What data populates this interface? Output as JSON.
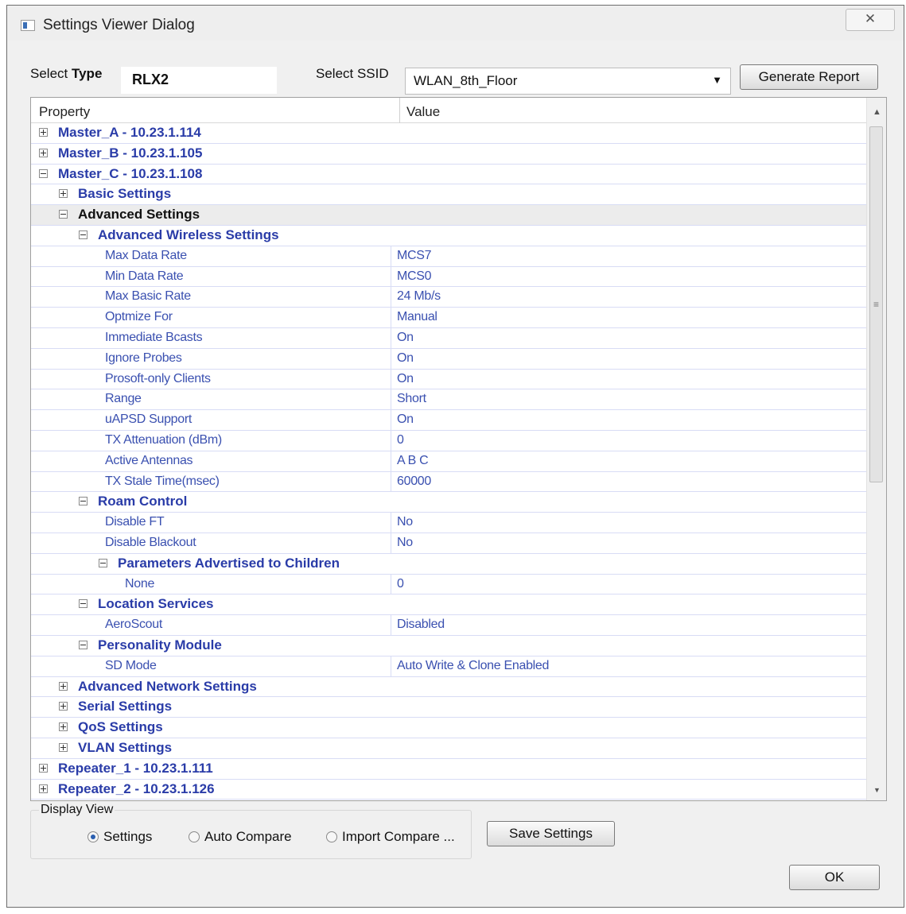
{
  "window": {
    "title": "Settings Viewer Dialog",
    "close_glyph": "✕"
  },
  "toolbar": {
    "select_type_label_plain": "Select",
    "select_type_label_bold": "Type",
    "type_value": "RLX2",
    "select_ssid_label": "Select SSID",
    "ssid_value": "WLAN_8th_Floor",
    "generate_report_label": "Generate Report"
  },
  "grid": {
    "col_property": "Property",
    "col_value": "Value",
    "rows": [
      {
        "kind": "cat",
        "level": 0,
        "state": "plus",
        "label": "Master_A - 10.23.1.114"
      },
      {
        "kind": "cat",
        "level": 0,
        "state": "plus",
        "label": "Master_B - 10.23.1.105"
      },
      {
        "kind": "cat",
        "level": 0,
        "state": "minus",
        "label": "Master_C - 10.23.1.108"
      },
      {
        "kind": "cat",
        "level": 1,
        "state": "plus",
        "label": "Basic Settings"
      },
      {
        "kind": "cat",
        "level": 1,
        "state": "minus",
        "label": "Advanced Settings",
        "active": true
      },
      {
        "kind": "cat",
        "level": 2,
        "state": "minus",
        "label": "Advanced Wireless Settings"
      },
      {
        "kind": "prop",
        "level": 3,
        "label": "Max Data Rate",
        "value": "MCS7"
      },
      {
        "kind": "prop",
        "level": 3,
        "label": "Min Data Rate",
        "value": "MCS0"
      },
      {
        "kind": "prop",
        "level": 3,
        "label": "Max Basic Rate",
        "value": "24 Mb/s"
      },
      {
        "kind": "prop",
        "level": 3,
        "label": "Optmize For",
        "value": "Manual"
      },
      {
        "kind": "prop",
        "level": 3,
        "label": "Immediate Bcasts",
        "value": "On"
      },
      {
        "kind": "prop",
        "level": 3,
        "label": "Ignore Probes",
        "value": "On"
      },
      {
        "kind": "prop",
        "level": 3,
        "label": "Prosoft-only Clients",
        "value": "On"
      },
      {
        "kind": "prop",
        "level": 3,
        "label": "Range",
        "value": "Short"
      },
      {
        "kind": "prop",
        "level": 3,
        "label": "uAPSD Support",
        "value": "On"
      },
      {
        "kind": "prop",
        "level": 3,
        "label": "TX Attenuation (dBm)",
        "value": "0"
      },
      {
        "kind": "prop",
        "level": 3,
        "label": "Active Antennas",
        "value": "A B C"
      },
      {
        "kind": "prop",
        "level": 3,
        "label": "TX Stale Time(msec)",
        "value": "60000"
      },
      {
        "kind": "cat",
        "level": 2,
        "state": "minus",
        "label": "Roam Control"
      },
      {
        "kind": "prop",
        "level": 3,
        "label": "Disable FT",
        "value": "No"
      },
      {
        "kind": "prop",
        "level": 3,
        "label": "Disable Blackout",
        "value": "No"
      },
      {
        "kind": "cat",
        "level": 3,
        "state": "minus",
        "label": "Parameters Advertised to Children"
      },
      {
        "kind": "prop",
        "level": 4,
        "label": "None",
        "value": "0"
      },
      {
        "kind": "cat",
        "level": 2,
        "state": "minus",
        "label": "Location Services"
      },
      {
        "kind": "prop",
        "level": 3,
        "label": "AeroScout",
        "value": "Disabled"
      },
      {
        "kind": "cat",
        "level": 2,
        "state": "minus",
        "label": "Personality Module"
      },
      {
        "kind": "prop",
        "level": 3,
        "label": "SD Mode",
        "value": "Auto Write & Clone Enabled"
      },
      {
        "kind": "cat",
        "level": 1,
        "state": "plus",
        "label": "Advanced Network Settings"
      },
      {
        "kind": "cat",
        "level": 1,
        "state": "plus",
        "label": "Serial Settings"
      },
      {
        "kind": "cat",
        "level": 1,
        "state": "plus",
        "label": "QoS Settings"
      },
      {
        "kind": "cat",
        "level": 1,
        "state": "plus",
        "label": "VLAN Settings"
      },
      {
        "kind": "cat",
        "level": 0,
        "state": "plus",
        "label": "Repeater_1 - 10.23.1.111"
      },
      {
        "kind": "cat",
        "level": 0,
        "state": "plus",
        "label": "Repeater_2 - 10.23.1.126"
      }
    ]
  },
  "display_view": {
    "legend": "Display View",
    "options": [
      {
        "label": "Settings",
        "selected": true
      },
      {
        "label": "Auto Compare",
        "selected": false
      },
      {
        "label": "Import Compare ...",
        "selected": false
      }
    ]
  },
  "buttons": {
    "save_settings": "Save Settings",
    "ok": "OK"
  },
  "colors": {
    "category_text": "#2a3ca8",
    "property_text": "#3a50b0",
    "row_line": "#d8dcf5"
  }
}
